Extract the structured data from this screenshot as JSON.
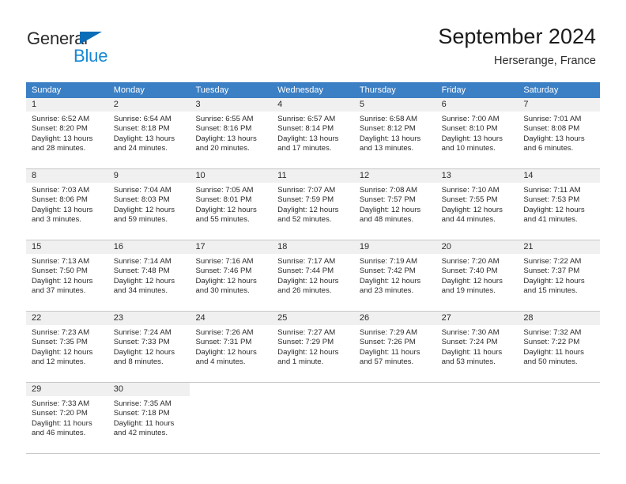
{
  "brand": {
    "name_primary": "General",
    "name_secondary": "Blue",
    "triangle_color": "#0b6cb7",
    "blue_color": "#1787d4"
  },
  "header": {
    "title": "September 2024",
    "subtitle": "Herserange, France"
  },
  "calendar": {
    "header_bg": "#3b7fc4",
    "daynum_bg": "#f0f0f0",
    "weekdays": [
      "Sunday",
      "Monday",
      "Tuesday",
      "Wednesday",
      "Thursday",
      "Friday",
      "Saturday"
    ],
    "weeks": [
      [
        {
          "day": "1",
          "sunrise": "Sunrise: 6:52 AM",
          "sunset": "Sunset: 8:20 PM",
          "daylight": "Daylight: 13 hours and 28 minutes."
        },
        {
          "day": "2",
          "sunrise": "Sunrise: 6:54 AM",
          "sunset": "Sunset: 8:18 PM",
          "daylight": "Daylight: 13 hours and 24 minutes."
        },
        {
          "day": "3",
          "sunrise": "Sunrise: 6:55 AM",
          "sunset": "Sunset: 8:16 PM",
          "daylight": "Daylight: 13 hours and 20 minutes."
        },
        {
          "day": "4",
          "sunrise": "Sunrise: 6:57 AM",
          "sunset": "Sunset: 8:14 PM",
          "daylight": "Daylight: 13 hours and 17 minutes."
        },
        {
          "day": "5",
          "sunrise": "Sunrise: 6:58 AM",
          "sunset": "Sunset: 8:12 PM",
          "daylight": "Daylight: 13 hours and 13 minutes."
        },
        {
          "day": "6",
          "sunrise": "Sunrise: 7:00 AM",
          "sunset": "Sunset: 8:10 PM",
          "daylight": "Daylight: 13 hours and 10 minutes."
        },
        {
          "day": "7",
          "sunrise": "Sunrise: 7:01 AM",
          "sunset": "Sunset: 8:08 PM",
          "daylight": "Daylight: 13 hours and 6 minutes."
        }
      ],
      [
        {
          "day": "8",
          "sunrise": "Sunrise: 7:03 AM",
          "sunset": "Sunset: 8:06 PM",
          "daylight": "Daylight: 13 hours and 3 minutes."
        },
        {
          "day": "9",
          "sunrise": "Sunrise: 7:04 AM",
          "sunset": "Sunset: 8:03 PM",
          "daylight": "Daylight: 12 hours and 59 minutes."
        },
        {
          "day": "10",
          "sunrise": "Sunrise: 7:05 AM",
          "sunset": "Sunset: 8:01 PM",
          "daylight": "Daylight: 12 hours and 55 minutes."
        },
        {
          "day": "11",
          "sunrise": "Sunrise: 7:07 AM",
          "sunset": "Sunset: 7:59 PM",
          "daylight": "Daylight: 12 hours and 52 minutes."
        },
        {
          "day": "12",
          "sunrise": "Sunrise: 7:08 AM",
          "sunset": "Sunset: 7:57 PM",
          "daylight": "Daylight: 12 hours and 48 minutes."
        },
        {
          "day": "13",
          "sunrise": "Sunrise: 7:10 AM",
          "sunset": "Sunset: 7:55 PM",
          "daylight": "Daylight: 12 hours and 44 minutes."
        },
        {
          "day": "14",
          "sunrise": "Sunrise: 7:11 AM",
          "sunset": "Sunset: 7:53 PM",
          "daylight": "Daylight: 12 hours and 41 minutes."
        }
      ],
      [
        {
          "day": "15",
          "sunrise": "Sunrise: 7:13 AM",
          "sunset": "Sunset: 7:50 PM",
          "daylight": "Daylight: 12 hours and 37 minutes."
        },
        {
          "day": "16",
          "sunrise": "Sunrise: 7:14 AM",
          "sunset": "Sunset: 7:48 PM",
          "daylight": "Daylight: 12 hours and 34 minutes."
        },
        {
          "day": "17",
          "sunrise": "Sunrise: 7:16 AM",
          "sunset": "Sunset: 7:46 PM",
          "daylight": "Daylight: 12 hours and 30 minutes."
        },
        {
          "day": "18",
          "sunrise": "Sunrise: 7:17 AM",
          "sunset": "Sunset: 7:44 PM",
          "daylight": "Daylight: 12 hours and 26 minutes."
        },
        {
          "day": "19",
          "sunrise": "Sunrise: 7:19 AM",
          "sunset": "Sunset: 7:42 PM",
          "daylight": "Daylight: 12 hours and 23 minutes."
        },
        {
          "day": "20",
          "sunrise": "Sunrise: 7:20 AM",
          "sunset": "Sunset: 7:40 PM",
          "daylight": "Daylight: 12 hours and 19 minutes."
        },
        {
          "day": "21",
          "sunrise": "Sunrise: 7:22 AM",
          "sunset": "Sunset: 7:37 PM",
          "daylight": "Daylight: 12 hours and 15 minutes."
        }
      ],
      [
        {
          "day": "22",
          "sunrise": "Sunrise: 7:23 AM",
          "sunset": "Sunset: 7:35 PM",
          "daylight": "Daylight: 12 hours and 12 minutes."
        },
        {
          "day": "23",
          "sunrise": "Sunrise: 7:24 AM",
          "sunset": "Sunset: 7:33 PM",
          "daylight": "Daylight: 12 hours and 8 minutes."
        },
        {
          "day": "24",
          "sunrise": "Sunrise: 7:26 AM",
          "sunset": "Sunset: 7:31 PM",
          "daylight": "Daylight: 12 hours and 4 minutes."
        },
        {
          "day": "25",
          "sunrise": "Sunrise: 7:27 AM",
          "sunset": "Sunset: 7:29 PM",
          "daylight": "Daylight: 12 hours and 1 minute."
        },
        {
          "day": "26",
          "sunrise": "Sunrise: 7:29 AM",
          "sunset": "Sunset: 7:26 PM",
          "daylight": "Daylight: 11 hours and 57 minutes."
        },
        {
          "day": "27",
          "sunrise": "Sunrise: 7:30 AM",
          "sunset": "Sunset: 7:24 PM",
          "daylight": "Daylight: 11 hours and 53 minutes."
        },
        {
          "day": "28",
          "sunrise": "Sunrise: 7:32 AM",
          "sunset": "Sunset: 7:22 PM",
          "daylight": "Daylight: 11 hours and 50 minutes."
        }
      ],
      [
        {
          "day": "29",
          "sunrise": "Sunrise: 7:33 AM",
          "sunset": "Sunset: 7:20 PM",
          "daylight": "Daylight: 11 hours and 46 minutes."
        },
        {
          "day": "30",
          "sunrise": "Sunrise: 7:35 AM",
          "sunset": "Sunset: 7:18 PM",
          "daylight": "Daylight: 11 hours and 42 minutes."
        },
        {
          "day": "",
          "sunrise": "",
          "sunset": "",
          "daylight": ""
        },
        {
          "day": "",
          "sunrise": "",
          "sunset": "",
          "daylight": ""
        },
        {
          "day": "",
          "sunrise": "",
          "sunset": "",
          "daylight": ""
        },
        {
          "day": "",
          "sunrise": "",
          "sunset": "",
          "daylight": ""
        },
        {
          "day": "",
          "sunrise": "",
          "sunset": "",
          "daylight": ""
        }
      ]
    ]
  }
}
